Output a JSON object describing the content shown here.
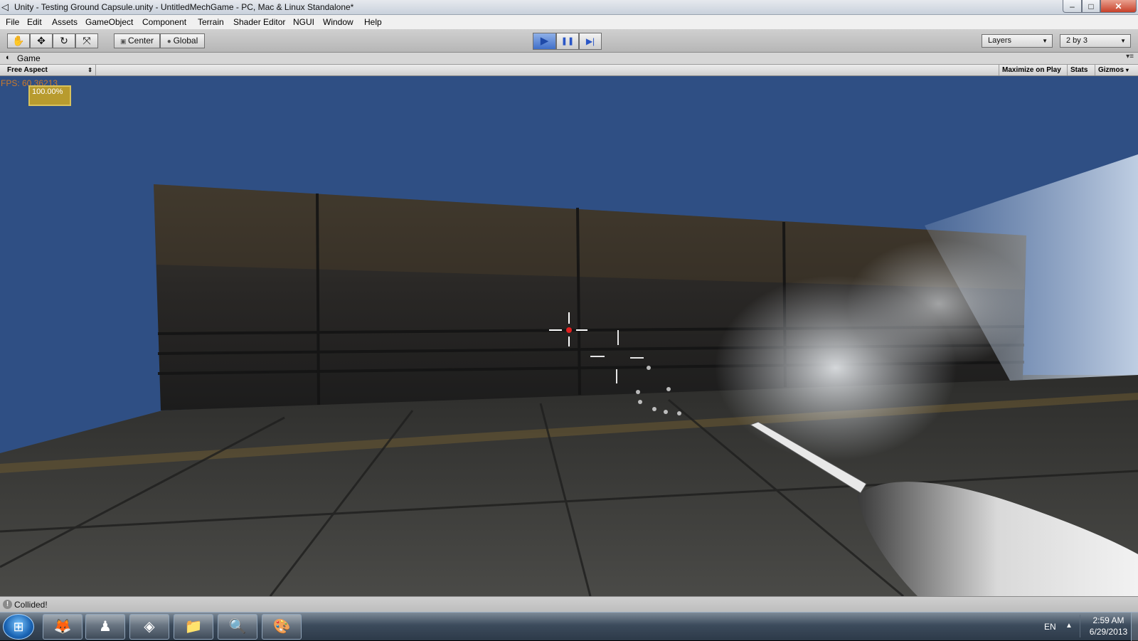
{
  "window": {
    "title": "Unity - Testing Ground Capsule.unity - UntitledMechGame - PC, Mac & Linux Standalone*",
    "controls": {
      "minimize": "–",
      "maximize": "□",
      "close": "✕"
    }
  },
  "menu": [
    "File",
    "Edit",
    "Assets",
    "GameObject",
    "Component",
    "Terrain",
    "Shader Editor",
    "NGUI",
    "Window",
    "Help"
  ],
  "toolbar": {
    "tools": [
      {
        "name": "hand-tool",
        "glyph": "✋"
      },
      {
        "name": "move-tool",
        "glyph": "✥"
      },
      {
        "name": "rotate-tool",
        "glyph": "↻"
      },
      {
        "name": "scale-tool",
        "glyph": "⤧"
      }
    ],
    "pivot_label": "Center",
    "space_label": "Global",
    "play": {
      "play": "▶",
      "pause": "❚❚",
      "step": "▶|"
    },
    "layers_label": "Layers",
    "layout_label": "2 by 3"
  },
  "game_panel": {
    "tab_label": "Game",
    "aspect_label": "Free Aspect",
    "maximize_label": "Maximize on Play",
    "stats_label": "Stats",
    "gizmos_label": "Gizmos"
  },
  "hud": {
    "fps_text": "FPS: 60.36213",
    "zoom_text": "100.00%"
  },
  "status": {
    "message": "Collided!",
    "icon": "!"
  },
  "taskbar": {
    "apps": [
      {
        "name": "firefox",
        "glyph": "🦊"
      },
      {
        "name": "game-app",
        "glyph": "♟"
      },
      {
        "name": "unity",
        "glyph": "◈"
      },
      {
        "name": "explorer",
        "glyph": "📁"
      },
      {
        "name": "search-app",
        "glyph": "🔍"
      },
      {
        "name": "paint",
        "glyph": "🎨"
      }
    ],
    "language": "EN",
    "time": "2:59 AM",
    "date": "6/29/2013"
  },
  "colors": {
    "sky": "#2f4f84",
    "wall": "#2a2a2a",
    "floor": "#3a3a38",
    "fps": "#cc7a2a",
    "zoom_box": "#b89b2e"
  }
}
